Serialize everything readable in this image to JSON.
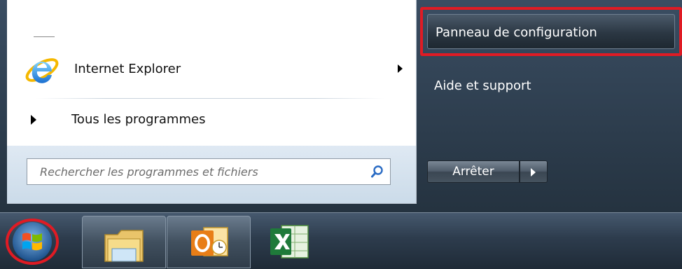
{
  "start_menu": {
    "pinned": [
      {
        "label": "Internet Explorer",
        "icon": "internet-explorer-icon"
      }
    ],
    "all_programs_label": "Tous les programmes",
    "search": {
      "placeholder": "Rechercher les programmes et fichiers",
      "value": ""
    }
  },
  "right_panel": {
    "items": [
      {
        "label": "Panneau de configuration",
        "highlighted": true
      },
      {
        "label": "Aide et support",
        "highlighted": false
      }
    ],
    "shutdown_label": "Arrêter"
  },
  "taskbar": {
    "start_button": "windows-start-orb-icon",
    "apps": [
      {
        "name": "explorer",
        "icon": "folder-icon"
      },
      {
        "name": "outlook",
        "icon": "outlook-icon"
      },
      {
        "name": "excel",
        "icon": "excel-icon"
      }
    ]
  },
  "colors": {
    "highlight_border": "#e01b24"
  }
}
